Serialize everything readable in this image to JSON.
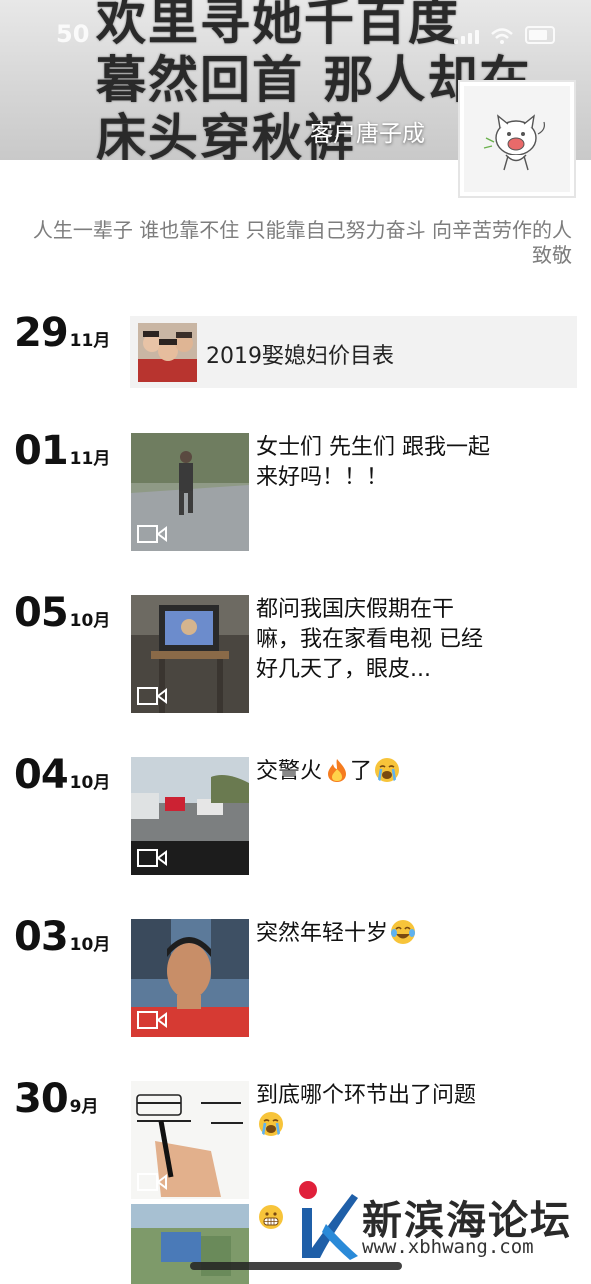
{
  "status_bar": {
    "time": "50"
  },
  "cover": {
    "lines": [
      "欢里寻她千百度",
      "暮然回首 那人却在",
      "床头穿秋裤"
    ]
  },
  "profile": {
    "name": "客户唐子成",
    "signature": "人生一辈子  谁也靠不住 只能靠自己努力奋斗 向辛苦劳作的人致敬"
  },
  "posts": [
    {
      "day": "29",
      "month": "11月",
      "type": "link",
      "title": "2019娶媳妇价目表"
    },
    {
      "day": "01",
      "month": "11月",
      "type": "video",
      "text": "女士们 先生们 跟我一起来好吗！！！"
    },
    {
      "day": "05",
      "month": "10月",
      "type": "video",
      "text": "都问我国庆假期在干嘛，我在家看电视  已经好几天了，眼皮..."
    },
    {
      "day": "04",
      "month": "10月",
      "type": "video",
      "text": "交警火",
      "text_after": "了",
      "emojis": [
        "fire",
        "loudly-crying-face"
      ]
    },
    {
      "day": "03",
      "month": "10月",
      "type": "video",
      "text": "突然年轻十岁",
      "emojis": [
        "face-with-tears-of-joy"
      ]
    },
    {
      "day": "30",
      "month": "9月",
      "type": "video",
      "text": "到底哪个环节出了问题",
      "emojis": [
        "loudly-crying-face"
      ]
    },
    {
      "day": "",
      "month": "",
      "type": "image",
      "emojis": [
        "grimacing-face"
      ]
    }
  ],
  "watermark": {
    "name": "新滨海论坛",
    "url": "www.xbhwang.com"
  },
  "colors": {
    "link_card_bg": "#f2f2f2",
    "signature_text": "#7d7d7d",
    "emoji_yellow": "#f7c43a"
  }
}
